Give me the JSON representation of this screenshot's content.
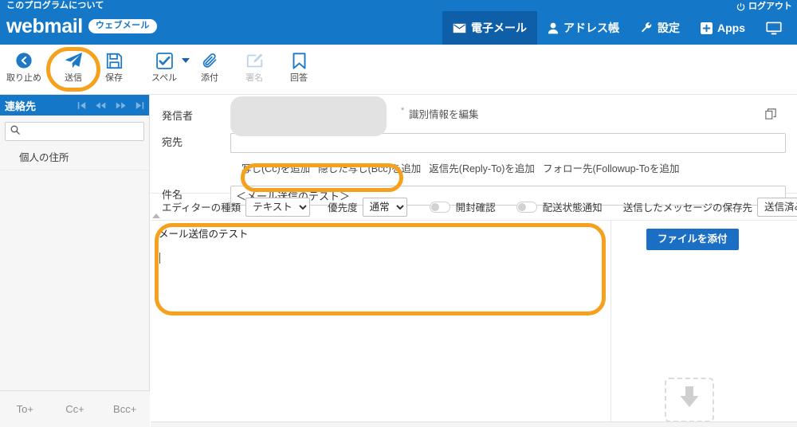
{
  "header": {
    "about_label": "このプログラムについて",
    "brand_name": "webmail",
    "brand_pill": "ウェブメール",
    "logout_label": "ログアウト",
    "brand_color": "#1577c8",
    "active_tab_color": "#0f5fa8",
    "nav": [
      {
        "label": "電子メール",
        "icon": "envelope-icon",
        "active": true
      },
      {
        "label": "アドレス帳",
        "icon": "person-icon",
        "active": false
      },
      {
        "label": "設定",
        "icon": "wrench-icon",
        "active": false
      },
      {
        "label": "Apps",
        "icon": "plus-box-icon",
        "active": false
      },
      {
        "label": "",
        "icon": "monitor-icon",
        "active": false
      }
    ]
  },
  "toolbar": {
    "items": [
      {
        "label": "取り止め",
        "icon": "back-arrow-icon",
        "disabled": false,
        "dropdown": false
      },
      {
        "label": "送信",
        "icon": "paper-plane-icon",
        "disabled": false,
        "dropdown": false
      },
      {
        "label": "保存",
        "icon": "floppy-disk-icon",
        "disabled": false,
        "dropdown": false
      },
      {
        "label": "スペル",
        "icon": "spellcheck-icon",
        "disabled": false,
        "dropdown": true
      },
      {
        "label": "添付",
        "icon": "paperclip-icon",
        "disabled": false,
        "dropdown": false
      },
      {
        "label": "署名",
        "icon": "signature-pencil-icon",
        "disabled": true,
        "dropdown": false
      },
      {
        "label": "回答",
        "icon": "bookmark-icon",
        "disabled": false,
        "dropdown": false
      }
    ]
  },
  "sidebar": {
    "title": "連絡先",
    "search_placeholder": "",
    "search_value": "",
    "groups": [
      {
        "label": "個人の住所"
      }
    ],
    "footer_buttons": [
      {
        "label": "To+"
      },
      {
        "label": "Cc+"
      },
      {
        "label": "Bcc+"
      }
    ]
  },
  "compose": {
    "sender_label": "発信者",
    "sender_value": "",
    "identity_link": "識別情報を編集",
    "to_label": "宛先",
    "to_value": "",
    "cc_links": [
      "写し(Cc)を追加",
      "隠した写し(Bcc)を追加",
      "返信先(Reply-To)を追加",
      "フォロー先(Followup-Toを追加"
    ],
    "subject_label": "件名",
    "subject_value": "＜メール送信のテスト＞",
    "options": {
      "editor_label": "エディターの種類",
      "editor_value": "テキスト",
      "priority_label": "優先度",
      "priority_value": "通常",
      "read_receipt_label": "開封確認",
      "read_receipt_on": false,
      "dsn_label": "配送状態通知",
      "dsn_on": false,
      "save_to_label": "送信したメッセージの保存先",
      "save_to_value": "送信済み"
    },
    "body_text": "メール送信のテスト",
    "attach_button": "ファイルを添付",
    "dropzone_icon": "download-arrow-icon"
  },
  "annotations": {
    "highlight_color": "#f5a11e",
    "targets": [
      "送信",
      "件名",
      "本文"
    ]
  }
}
